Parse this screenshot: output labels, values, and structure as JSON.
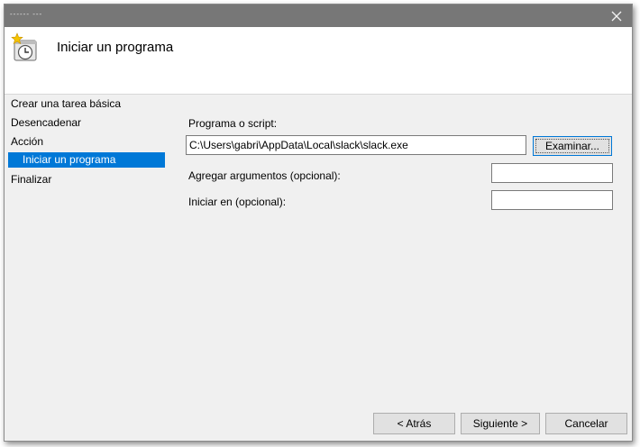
{
  "window": {
    "title": "------ ---"
  },
  "header": {
    "title": "Iniciar un programa",
    "icon": "clock-icon"
  },
  "steps": [
    {
      "label": "Crear una tarea básica",
      "active": false
    },
    {
      "label": "Desencadenar",
      "active": false
    },
    {
      "label": "Acción",
      "active": false
    },
    {
      "label": "Iniciar un programa",
      "active": true
    },
    {
      "label": "Finalizar",
      "active": false
    }
  ],
  "form": {
    "program_label": "Programa o script:",
    "program_value": "C:\\Users\\gabri\\AppData\\Local\\slack\\slack.exe",
    "browse_label": "Examinar...",
    "args_label": "Agregar argumentos (opcional):",
    "args_value": "",
    "startin_label": "Iniciar en (opcional):",
    "startin_value": ""
  },
  "footer": {
    "back_label": "< Atrás",
    "next_label": "Siguiente >",
    "cancel_label": "Cancelar"
  },
  "colors": {
    "selection": "#0078d7",
    "titlebar": "#777777",
    "window_bg": "#f0f0f0"
  }
}
